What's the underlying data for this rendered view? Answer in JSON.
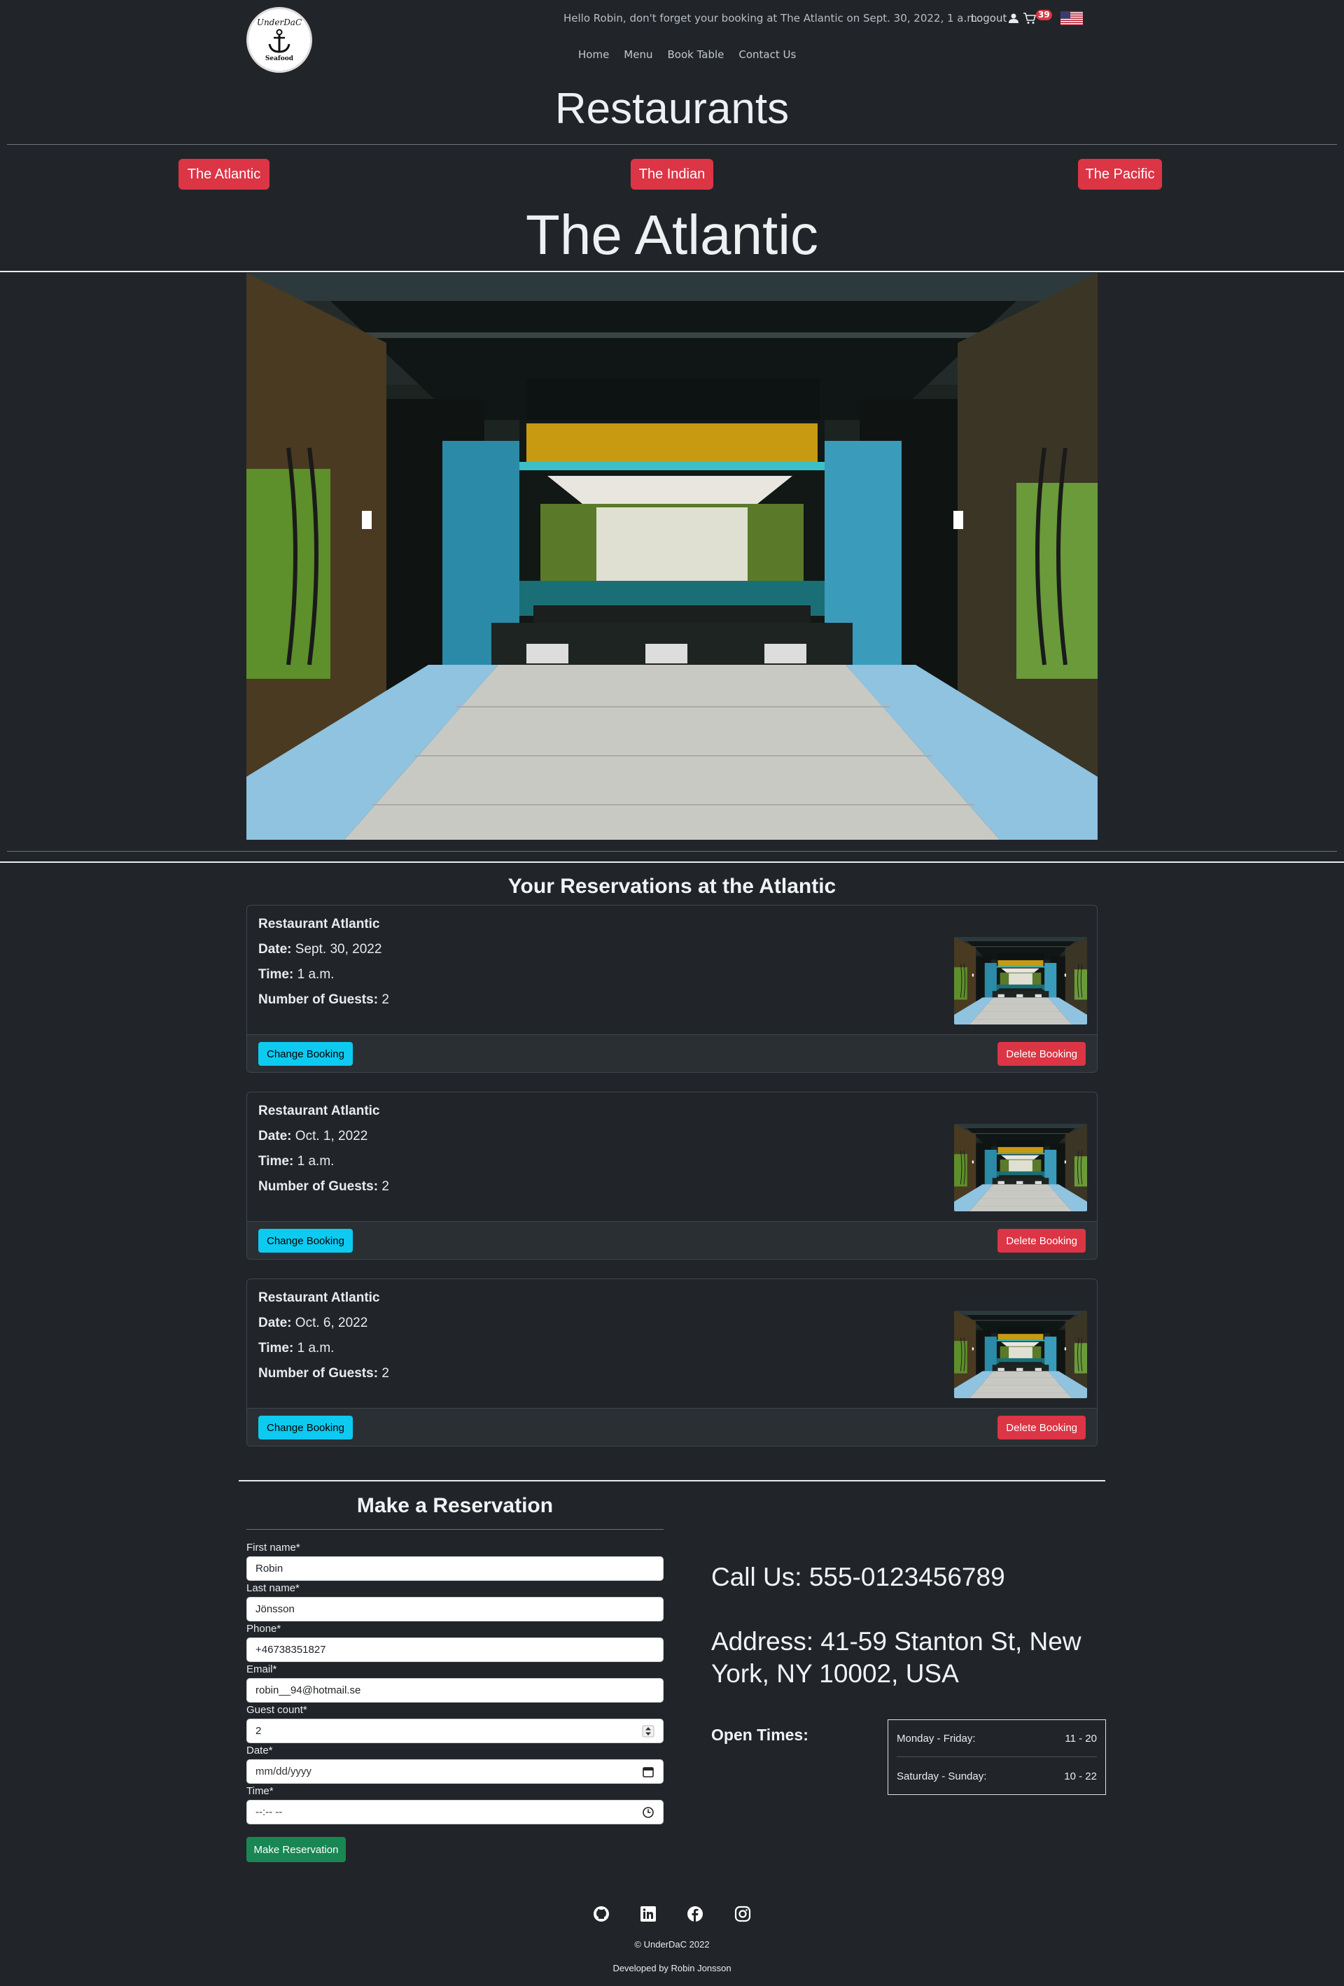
{
  "logo": {
    "top_text": "UnderDaC",
    "bottom_text": "Seafood",
    "icon": "anchor-icon"
  },
  "header": {
    "greeting": "Hello Robin, don't forget your booking at The Atlantic on Sept. 30, 2022, 1 a.m.",
    "logout_label": "Logout",
    "user_icon": "user-icon",
    "cart_icon": "cart-icon",
    "cart_count": "39",
    "flag_icon": "us-flag-icon"
  },
  "nav": {
    "items": [
      "Home",
      "Menu",
      "Book Table",
      "Contact Us"
    ]
  },
  "restaurants": {
    "heading": "Restaurants",
    "buttons": [
      "The Atlantic",
      "The Indian",
      "The Pacific"
    ]
  },
  "selected_restaurant": {
    "title": "The Atlantic"
  },
  "reservations": {
    "heading": "Your Reservations at the Atlantic",
    "labels": {
      "date": "Date:",
      "time": "Time:",
      "guests": "Number of Guests:"
    },
    "change_label": "Change Booking",
    "delete_label": "Delete Booking",
    "items": [
      {
        "restaurant": "Restaurant Atlantic",
        "date": "Sept. 30, 2022",
        "time": "1 a.m.",
        "guests": "2"
      },
      {
        "restaurant": "Restaurant Atlantic",
        "date": "Oct. 1, 2022",
        "time": "1 a.m.",
        "guests": "2"
      },
      {
        "restaurant": "Restaurant Atlantic",
        "date": "Oct. 6, 2022",
        "time": "1 a.m.",
        "guests": "2"
      }
    ]
  },
  "form": {
    "heading": "Make a Reservation",
    "fields": {
      "first_name": {
        "label": "First name*",
        "value": "Robin"
      },
      "last_name": {
        "label": "Last name*",
        "value": "Jönsson"
      },
      "phone": {
        "label": "Phone*",
        "value": "+46738351827"
      },
      "email": {
        "label": "Email*",
        "value": "robin__94@hotmail.se"
      },
      "guest_count": {
        "label": "Guest count*",
        "value": "2"
      },
      "date": {
        "label": "Date*",
        "placeholder": "mm/dd/yyyy"
      },
      "time": {
        "label": "Time*",
        "placeholder": "--:-- --"
      }
    },
    "submit_label": "Make Reservation"
  },
  "contact": {
    "call_label": "Call Us:",
    "phone": "555-0123456789",
    "address_label": "Address:",
    "address": "41-59 Stanton St, New York, NY 10002, USA",
    "open_label": "Open Times:",
    "hours": [
      {
        "days": "Monday - Friday:",
        "hours": "11 - 20"
      },
      {
        "days": "Saturday - Sunday:",
        "hours": "10 - 22"
      }
    ]
  },
  "footer": {
    "social_icons": [
      "github-icon",
      "linkedin-icon",
      "facebook-icon",
      "instagram-icon"
    ],
    "copyright": "© UnderDaC 2022",
    "developer": "Developed by Robin Jonsson"
  },
  "colors": {
    "background": "#212529",
    "danger": "#dc3545",
    "info": "#0dcaf0",
    "success": "#198754"
  }
}
